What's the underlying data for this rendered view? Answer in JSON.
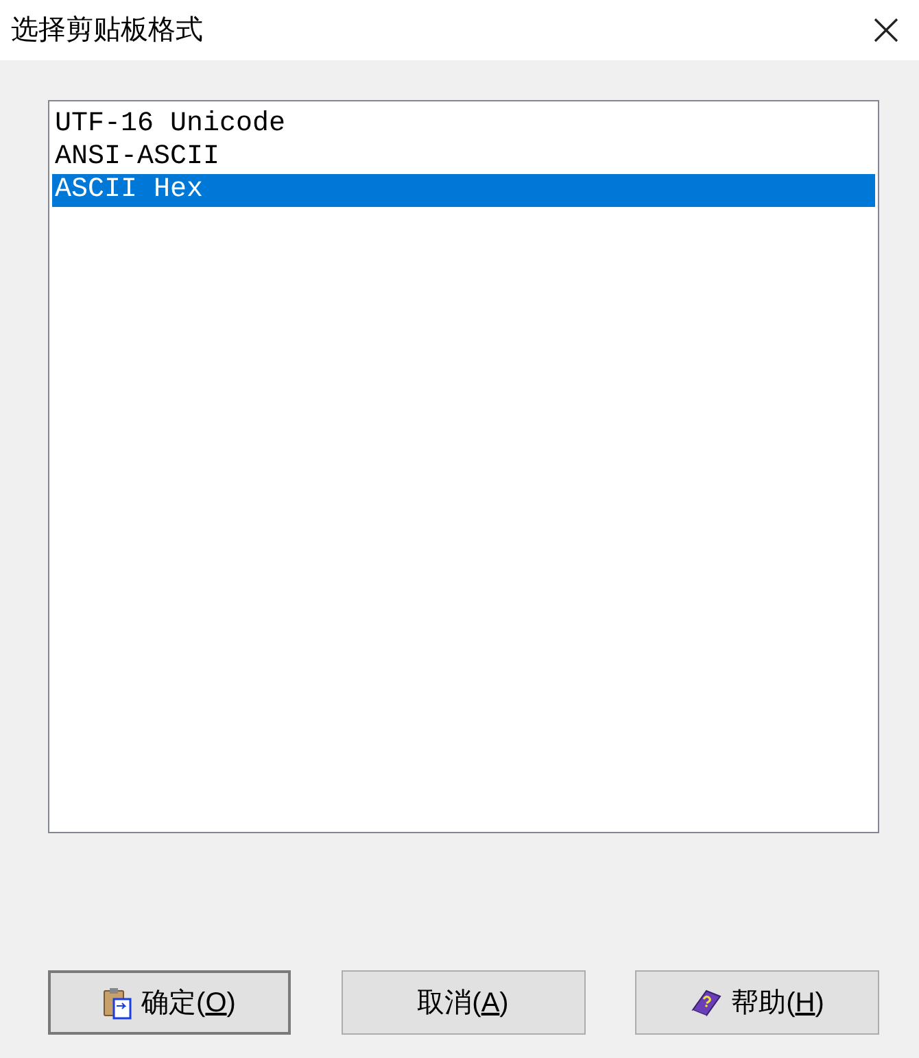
{
  "window": {
    "title": "选择剪贴板格式"
  },
  "list": {
    "items": [
      {
        "label": "UTF-16 Unicode",
        "selected": false
      },
      {
        "label": "ANSI-ASCII",
        "selected": false
      },
      {
        "label": "ASCII Hex",
        "selected": true
      }
    ]
  },
  "buttons": [
    {
      "label": "确定(",
      "mnemonic": "O",
      "label_end": ")",
      "kind": "paste",
      "default": true
    },
    {
      "label": "取消(",
      "mnemonic": "A",
      "label_end": ")",
      "kind": "plain",
      "default": false
    },
    {
      "label": "帮助(",
      "mnemonic": "H",
      "label_end": ")",
      "kind": "help",
      "default": false
    }
  ]
}
